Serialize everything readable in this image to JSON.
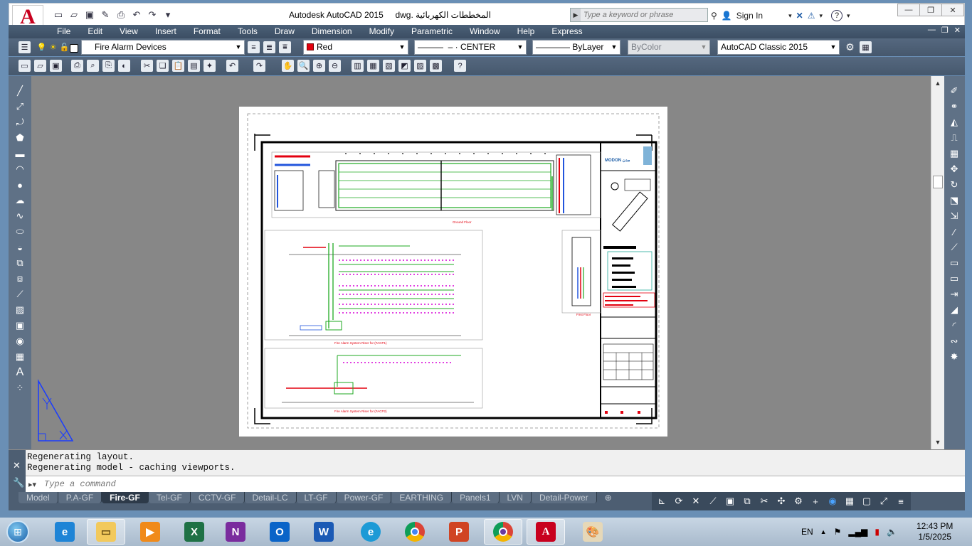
{
  "titlebar": {
    "app_title": "Autodesk AutoCAD 2015",
    "file_name": "المخططات الكهربائية .dwg",
    "search_placeholder": "Type a keyword or phrase",
    "sign_in": "Sign In",
    "quick_access_icons": [
      "new-icon",
      "open-icon",
      "save-icon",
      "saveas-icon",
      "print-icon",
      "undo-icon",
      "redo-icon",
      "dropdown-icon"
    ]
  },
  "menu": {
    "items": [
      "File",
      "Edit",
      "View",
      "Insert",
      "Format",
      "Tools",
      "Draw",
      "Dimension",
      "Modify",
      "Parametric",
      "Window",
      "Help",
      "Express"
    ]
  },
  "properties_toolbar": {
    "layer": "Fire Alarm Devices",
    "color": "Red",
    "color_hex": "#e3000f",
    "linetype": "CENTER",
    "lineweight": "ByLayer",
    "plotstyle": "ByColor",
    "workspace": "AutoCAD Classic 2015"
  },
  "drawing": {
    "ground_floor_caption": "Ground Floor",
    "first_floor_caption": "First Floor",
    "riser1_caption": "Fire Alarm System Riser for (FACP1)",
    "riser2_caption": "Fire Alarm System Riser for (FACP2)",
    "logo_text": "MODON مدن"
  },
  "command": {
    "history": [
      "Regenerating layout.",
      "Regenerating model - caching viewports."
    ],
    "placeholder": "Type a command"
  },
  "layout_tabs": {
    "tabs": [
      "Model",
      "P.A-GF",
      "Fire-GF",
      "Tel-GF",
      "CCTV-GF",
      "Detail-LC",
      "LT-GF",
      "Power-GF",
      "EARTHING",
      "Panels1",
      "LVN",
      "Detail-Power"
    ],
    "active": "Fire-GF"
  },
  "taskbar": {
    "apps": [
      "explorer",
      "internet-explorer",
      "media-player",
      "excel",
      "onenote",
      "outlook",
      "word",
      "edge",
      "chrome",
      "powerpoint",
      "chrome-profile",
      "autocad",
      "paint"
    ],
    "language": "EN",
    "time": "12:43 PM",
    "date": "1/5/2025"
  }
}
